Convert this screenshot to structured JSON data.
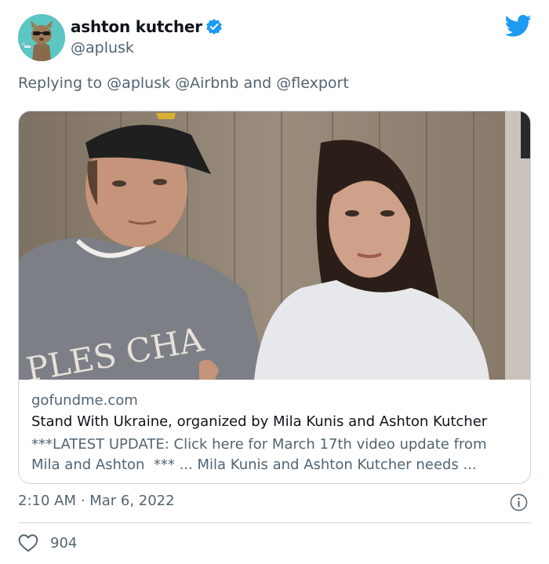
{
  "author": {
    "display_name": "ashton kutcher",
    "handle": "@aplusk",
    "verified": true
  },
  "reply": {
    "prefix": "Replying to",
    "mentions": [
      "@aplusk",
      "@Airbnb",
      "and",
      "@flexport"
    ]
  },
  "link_card": {
    "domain": "gofundme.com",
    "title": "Stand With Ukraine, organized by Mila Kunis and Ashton Kutcher",
    "description_line1": "***LATEST UPDATE: Click here for March 17th video update from",
    "description_line2": "Mila and Ashton  *** ... Mila Kunis and Ashton Kutcher needs ...",
    "image_text": "PLES CHA"
  },
  "meta": {
    "time": "2:10 AM",
    "separator": "·",
    "date": "Mar 6, 2022"
  },
  "engagement": {
    "likes": "904"
  },
  "colors": {
    "twitter_blue": "#1d9bf0",
    "secondary_text": "#536471",
    "border": "#cfd9de"
  },
  "icons": {
    "verified": "verified-badge-icon",
    "brand": "twitter-bird-icon",
    "info": "info-icon",
    "like": "heart-icon"
  }
}
